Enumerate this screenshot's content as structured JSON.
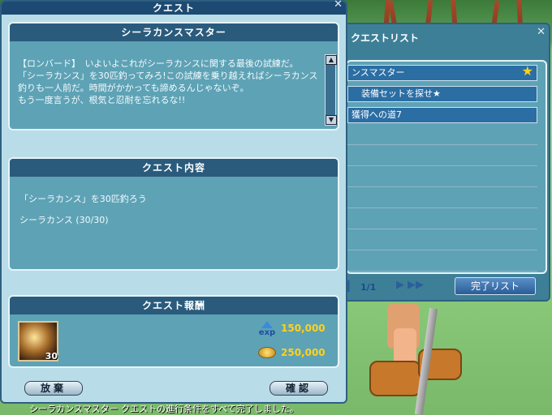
{
  "quest_window": {
    "title": "クエスト",
    "description_header": "シーラカンスマスター",
    "description_text": "【ロンバード】　いよいよこれがシーラカンスに関する最後の試練だ。\n「シーラカンス」を30匹釣ってみろ!この試練を乗り越えればシーラカンス釣りも一人前だ。時間がかかっても諦めるんじゃないぞ。\nもう一度言うが、根気と忍耐を忘れるな!!",
    "content_header": "クエスト内容",
    "objective": "「シーラカンス」を30匹釣ろう",
    "progress": "シーラカンス (30/30)",
    "reward_header": "クエスト報酬",
    "reward_item_count": "30",
    "exp_label": "exp",
    "exp_value": "150,000",
    "gold_value": "250,000",
    "abandon_button": "放棄",
    "confirm_button": "確認"
  },
  "quest_list_window": {
    "title": "クエストリスト",
    "items": [
      {
        "label": "ンスマスター"
      },
      {
        "label": "装備セットを探せ★"
      },
      {
        "label": "獲得への道7"
      }
    ],
    "page": "1/1",
    "complete_list_button": "完了リスト"
  },
  "status_message": "シーラカンスマスター クエストの進行条件をすべて完了しました。"
}
